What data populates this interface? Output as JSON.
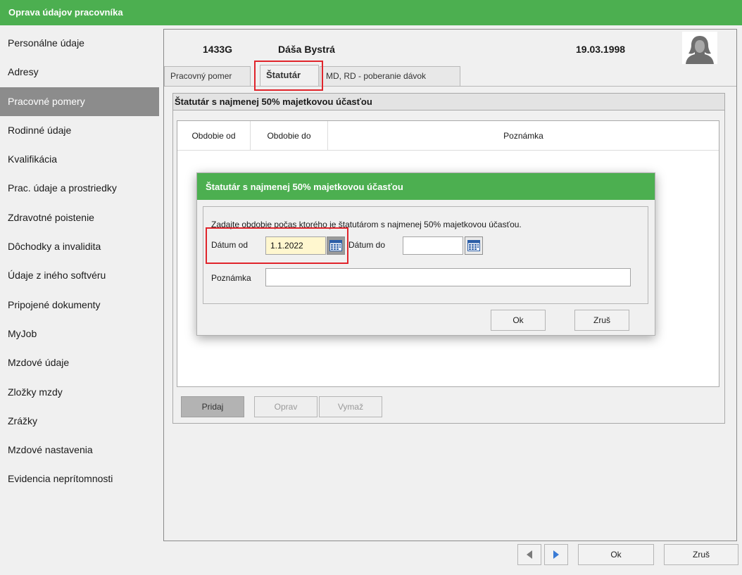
{
  "window": {
    "title": "Oprava údajov pracovníka"
  },
  "sidebar": {
    "items": [
      {
        "label": "Personálne údaje"
      },
      {
        "label": "Adresy"
      },
      {
        "label": "Pracovné pomery"
      },
      {
        "label": "Rodinné údaje"
      },
      {
        "label": "Kvalifikácia"
      },
      {
        "label": "Prac. údaje a prostriedky"
      },
      {
        "label": "Zdravotné poistenie"
      },
      {
        "label": "Dôchodky a invalidita"
      },
      {
        "label": "Údaje z iného softvéru"
      },
      {
        "label": "Pripojené dokumenty"
      },
      {
        "label": "MyJob"
      },
      {
        "label": "Mzdové údaje"
      },
      {
        "label": "Zložky mzdy"
      },
      {
        "label": "Zrážky"
      },
      {
        "label": "Mzdové nastavenia"
      },
      {
        "label": "Evidencia neprítomnosti"
      }
    ],
    "active_index": 2
  },
  "employee": {
    "code": "1433G",
    "name": "Dáša Bystrá",
    "birth_date": "19.03.1998",
    "avatar_icon": "person-silhouette-icon"
  },
  "tabs": [
    {
      "label": "Pracovný pomer"
    },
    {
      "label": "Štatutár"
    },
    {
      "label": "MD, RD - poberanie dávok"
    }
  ],
  "active_tab": 1,
  "section": {
    "title": "Štatutár s najmenej 50% majetkovou účasťou",
    "columns": [
      "Obdobie od",
      "Obdobie do",
      "Poznámka"
    ],
    "buttons": {
      "add": "Pridaj",
      "edit": "Oprav",
      "delete": "Vymaž"
    }
  },
  "dialog": {
    "title": "Štatutár s najmenej 50% majetkovou účasťou",
    "instruction": "Zadajte obdobie počas ktorého je štatutárom s najmenej 50% majetkovou účasťou.",
    "date_from_label": "Dátum od",
    "date_from_value": "1.1.2022",
    "date_to_label": "Dátum do",
    "date_to_value": "",
    "note_label": "Poznámka",
    "note_value": "",
    "ok_label": "Ok",
    "cancel_label": "Zruš"
  },
  "footer": {
    "ok_label": "Ok",
    "cancel_label": "Zruš"
  },
  "colors": {
    "accent_green": "#4caf50",
    "highlight_red": "#e0242b",
    "active_gray": "#8c8c8c"
  }
}
